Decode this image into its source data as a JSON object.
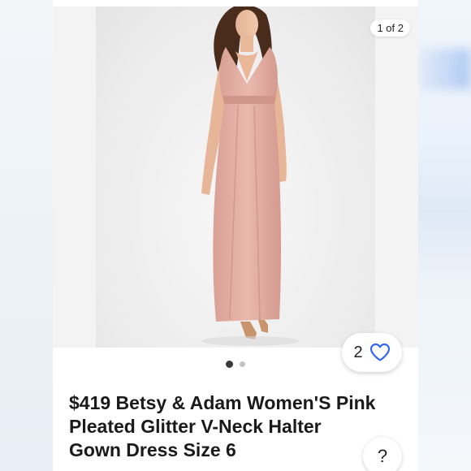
{
  "gallery": {
    "counter": "1 of 2",
    "total_images": 2,
    "current_index": 1
  },
  "watch": {
    "count": "2",
    "icon": "heart-outline-icon",
    "icon_color": "#3665f3"
  },
  "listing": {
    "title": "$419 Betsy & Adam Women'S Pink Pleated Glitter V-Neck Halter Gown Dress Size 6"
  },
  "help": {
    "label": "?"
  }
}
